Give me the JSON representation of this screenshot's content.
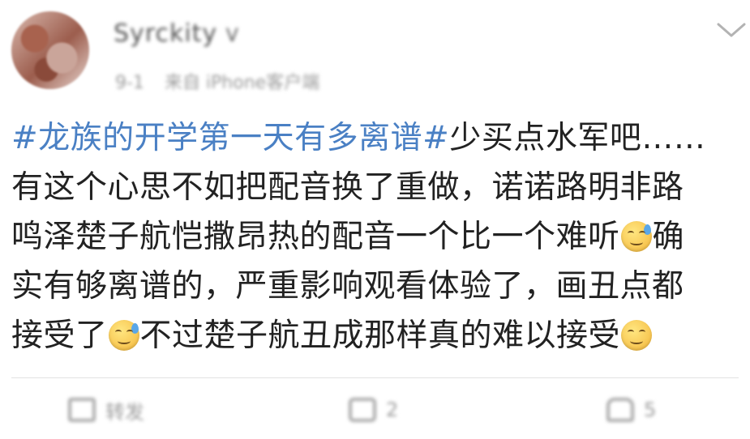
{
  "post": {
    "username": "Syrckity",
    "verified_badge": "V",
    "meta_time": "9-1",
    "meta_source": "来自 iPhone客户端",
    "menu_icon": "chevron-down-icon",
    "hashtag": "#龙族的开学第一天有多离谱#",
    "lines": [
      "少买点水军吧……",
      "有这个心思不如把配音换了重做，诺诺路明非路",
      "鸣泽楚子航恺撒昂热的配音一个比一个难听",
      "确",
      "实有够离谱的，严重影响观看体验了，画丑点都",
      "接受了",
      "不过楚子航丑成那样真的难以接受"
    ]
  },
  "actions": {
    "repost_label": "转发",
    "comment_count": "2",
    "like_count": "5"
  }
}
